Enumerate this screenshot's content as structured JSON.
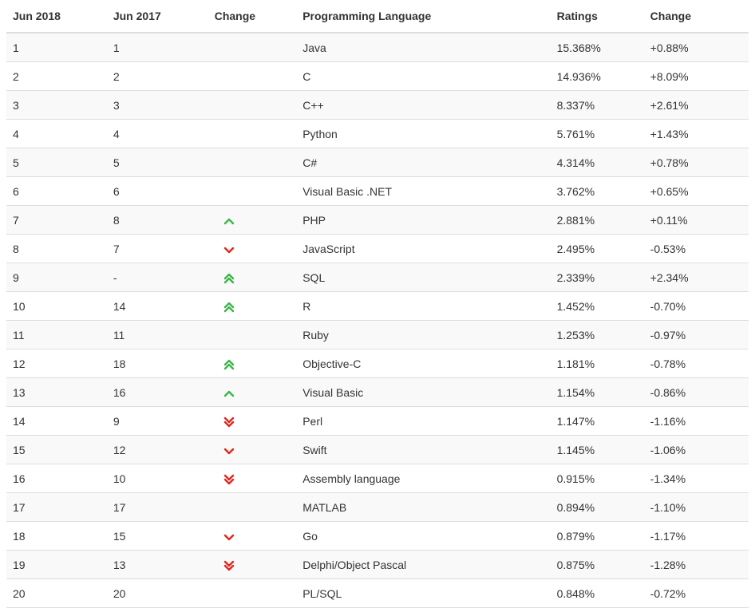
{
  "table": {
    "headers": {
      "rank_current": "Jun 2018",
      "rank_previous": "Jun 2017",
      "trend": "Change",
      "language": "Programming Language",
      "ratings": "Ratings",
      "change": "Change"
    },
    "colors": {
      "up": "#3cb548",
      "down": "#e0261c"
    },
    "rows": [
      {
        "rank": "1",
        "prev": "1",
        "trend": "none",
        "language": "Java",
        "rating": "15.368%",
        "change": "+0.88%"
      },
      {
        "rank": "2",
        "prev": "2",
        "trend": "none",
        "language": "C",
        "rating": "14.936%",
        "change": "+8.09%"
      },
      {
        "rank": "3",
        "prev": "3",
        "trend": "none",
        "language": "C++",
        "rating": "8.337%",
        "change": "+2.61%"
      },
      {
        "rank": "4",
        "prev": "4",
        "trend": "none",
        "language": "Python",
        "rating": "5.761%",
        "change": "+1.43%"
      },
      {
        "rank": "5",
        "prev": "5",
        "trend": "none",
        "language": "C#",
        "rating": "4.314%",
        "change": "+0.78%"
      },
      {
        "rank": "6",
        "prev": "6",
        "trend": "none",
        "language": "Visual Basic .NET",
        "rating": "3.762%",
        "change": "+0.65%"
      },
      {
        "rank": "7",
        "prev": "8",
        "trend": "up",
        "language": "PHP",
        "rating": "2.881%",
        "change": "+0.11%"
      },
      {
        "rank": "8",
        "prev": "7",
        "trend": "down",
        "language": "JavaScript",
        "rating": "2.495%",
        "change": "-0.53%"
      },
      {
        "rank": "9",
        "prev": "-",
        "trend": "up-double",
        "language": "SQL",
        "rating": "2.339%",
        "change": "+2.34%"
      },
      {
        "rank": "10",
        "prev": "14",
        "trend": "up-double",
        "language": "R",
        "rating": "1.452%",
        "change": "-0.70%"
      },
      {
        "rank": "11",
        "prev": "11",
        "trend": "none",
        "language": "Ruby",
        "rating": "1.253%",
        "change": "-0.97%"
      },
      {
        "rank": "12",
        "prev": "18",
        "trend": "up-double",
        "language": "Objective-C",
        "rating": "1.181%",
        "change": "-0.78%"
      },
      {
        "rank": "13",
        "prev": "16",
        "trend": "up",
        "language": "Visual Basic",
        "rating": "1.154%",
        "change": "-0.86%"
      },
      {
        "rank": "14",
        "prev": "9",
        "trend": "down-double",
        "language": "Perl",
        "rating": "1.147%",
        "change": "-1.16%"
      },
      {
        "rank": "15",
        "prev": "12",
        "trend": "down",
        "language": "Swift",
        "rating": "1.145%",
        "change": "-1.06%"
      },
      {
        "rank": "16",
        "prev": "10",
        "trend": "down-double",
        "language": "Assembly language",
        "rating": "0.915%",
        "change": "-1.34%"
      },
      {
        "rank": "17",
        "prev": "17",
        "trend": "none",
        "language": "MATLAB",
        "rating": "0.894%",
        "change": "-1.10%"
      },
      {
        "rank": "18",
        "prev": "15",
        "trend": "down",
        "language": "Go",
        "rating": "0.879%",
        "change": "-1.17%"
      },
      {
        "rank": "19",
        "prev": "13",
        "trend": "down-double",
        "language": "Delphi/Object Pascal",
        "rating": "0.875%",
        "change": "-1.28%"
      },
      {
        "rank": "20",
        "prev": "20",
        "trend": "none",
        "language": "PL/SQL",
        "rating": "0.848%",
        "change": "-0.72%"
      }
    ]
  }
}
